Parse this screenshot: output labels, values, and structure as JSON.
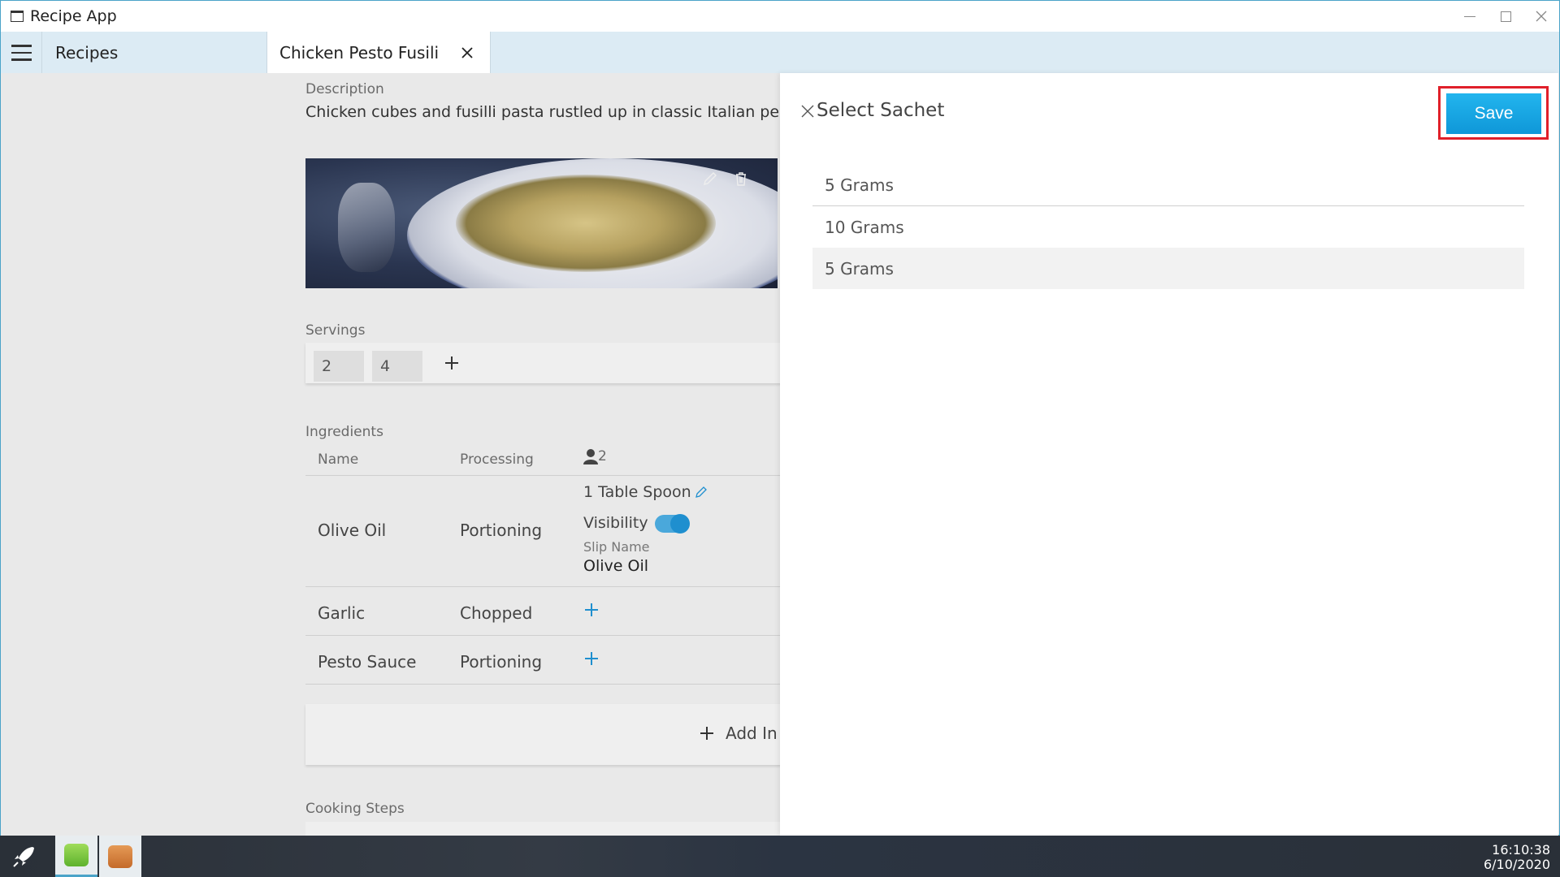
{
  "window": {
    "title": "Recipe App"
  },
  "tabs": {
    "menu_icon": "hamburger-icon",
    "recipes_label": "Recipes",
    "active_label": "Chicken Pesto Fusili"
  },
  "recipe": {
    "description_label": "Description",
    "description": "Chicken cubes and fusilli pasta rustled up in classic Italian pe",
    "servings_label": "Servings",
    "servings": [
      "2",
      "4"
    ],
    "ingredients_label": "Ingredients",
    "columns": {
      "name": "Name",
      "processing": "Processing",
      "servings_count": "2"
    },
    "ingredients": [
      {
        "name": "Olive Oil",
        "processing": "Portioning",
        "portion": "1 Table Spoon",
        "visibility_label": "Visibility",
        "visibility_on": true,
        "slip_name_label": "Slip Name",
        "slip_name": "Olive Oil"
      },
      {
        "name": "Garlic",
        "processing": "Chopped"
      },
      {
        "name": "Pesto Sauce",
        "processing": "Portioning"
      }
    ],
    "add_ingredient_label": "Add In",
    "cooking_steps_label": "Cooking Steps"
  },
  "panel": {
    "title": "Select Sachet",
    "save_label": "Save",
    "options": [
      "5 Grams",
      "10 Grams",
      "5 Grams"
    ],
    "selected_index": 2
  },
  "taskbar": {
    "time": "16:10:38",
    "date": "6/10/2020"
  },
  "colors": {
    "accent": "#1fa8e6",
    "highlight": "#e0202a",
    "toggle": "#1f8fcf"
  }
}
